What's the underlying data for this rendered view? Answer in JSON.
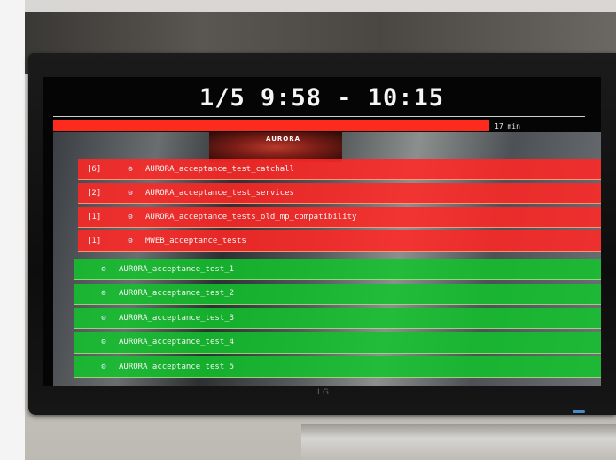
{
  "screen": {
    "title": "1/5 9:58 - 10:15",
    "progress": {
      "label": "17 min",
      "fraction": 0.82,
      "color": "#ff2a1e"
    },
    "artwork_text": "AURORA",
    "failing_jobs": [
      {
        "prefix": "[6]",
        "status": "",
        "icon": "build-status-icon",
        "name": "AURORA_acceptance_test_catchall"
      },
      {
        "prefix": "[2]",
        "status": "",
        "icon": "build-status-icon",
        "name": "AURORA_acceptance_test_services"
      },
      {
        "prefix": "[1]",
        "status": "",
        "icon": "build-status-icon",
        "name": "AURORA_acceptance_tests_old_mp_compatibility"
      },
      {
        "prefix": "[1]",
        "status": "",
        "icon": "build-status-icon",
        "name": "MWEB_acceptance_tests"
      }
    ],
    "passing_jobs": [
      {
        "prefix": "",
        "status": "",
        "icon": "build-status-icon",
        "name": "AURORA_acceptance_test_1"
      },
      {
        "prefix": "",
        "status": "",
        "icon": "build-status-icon",
        "name": "AURORA_acceptance_test_2"
      },
      {
        "prefix": "",
        "status": "",
        "icon": "build-status-icon",
        "name": "AURORA_acceptance_test_3"
      },
      {
        "prefix": "",
        "status": "",
        "icon": "build-status-icon",
        "name": "AURORA_acceptance_test_4"
      },
      {
        "prefix": "",
        "status": "",
        "icon": "build-status-icon",
        "name": "AURORA_acceptance_test_5"
      }
    ],
    "colors": {
      "failing": "#ff2826",
      "passing": "#12c42c"
    }
  },
  "tv": {
    "brand": "LG"
  }
}
